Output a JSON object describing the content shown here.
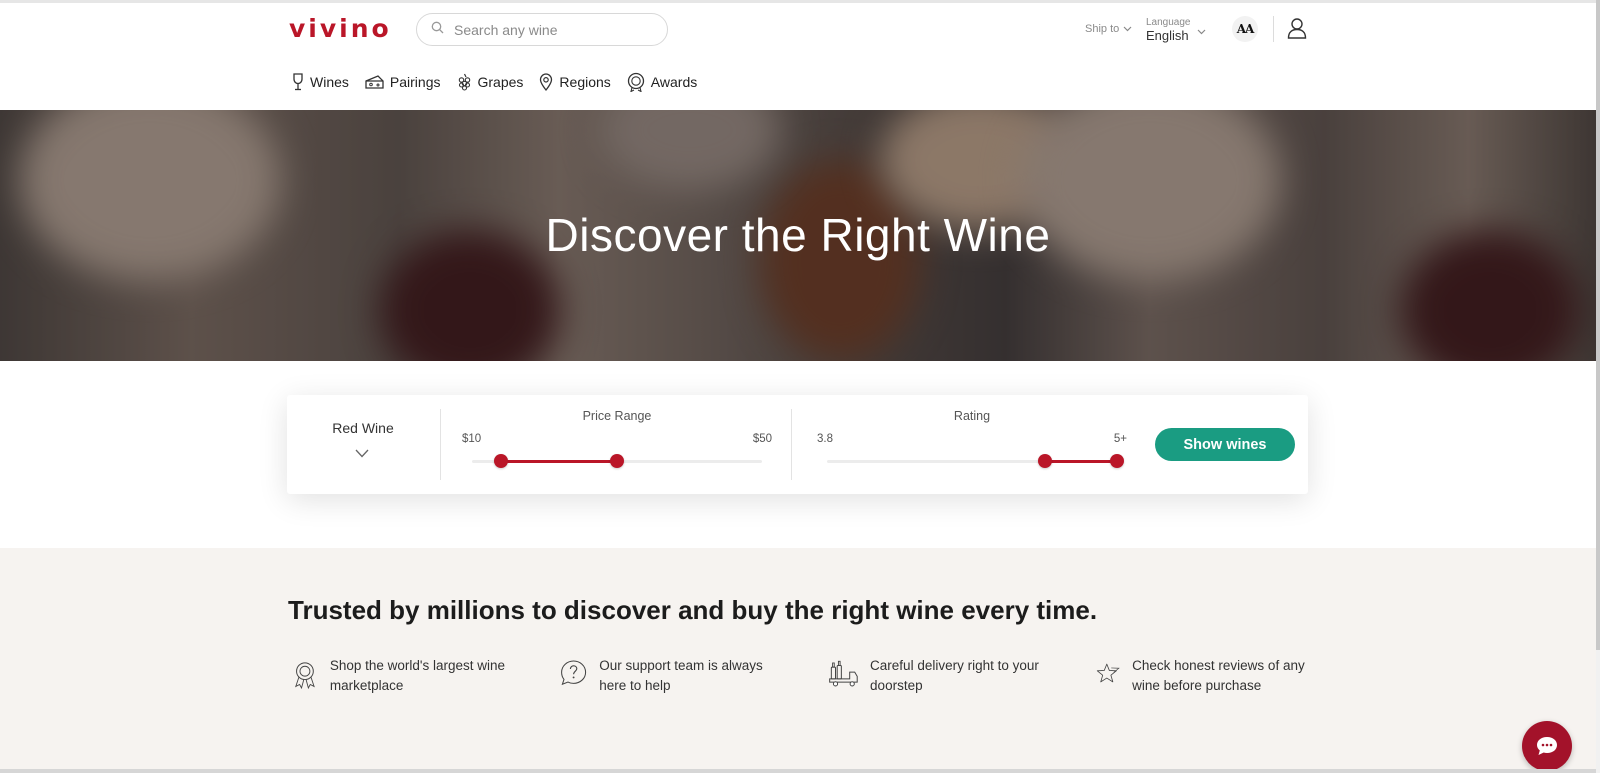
{
  "header": {
    "logo": "vivino",
    "search_placeholder": "Search any wine",
    "ship_to": "Ship to",
    "language_label": "Language",
    "language_value": "English",
    "font_size_toggle": "AA"
  },
  "nav": {
    "items": [
      {
        "label": "Wines",
        "icon": "wine-glass-icon"
      },
      {
        "label": "Pairings",
        "icon": "cheese-icon"
      },
      {
        "label": "Grapes",
        "icon": "grapes-icon"
      },
      {
        "label": "Regions",
        "icon": "map-pin-icon"
      },
      {
        "label": "Awards",
        "icon": "award-icon"
      }
    ]
  },
  "hero": {
    "title": "Discover the Right Wine"
  },
  "filters": {
    "wine_type": "Red Wine",
    "price": {
      "title": "Price Range",
      "min_label": "$10",
      "max_label": "$50",
      "low_fraction": 0.1,
      "high_fraction": 0.5
    },
    "rating": {
      "title": "Rating",
      "min_label": "3.8",
      "max_label": "5+",
      "low_fraction": 0.75,
      "high_fraction": 1.0
    },
    "show_button": "Show wines"
  },
  "trusted": {
    "title": "Trusted by millions to discover and buy the right wine every time.",
    "features": [
      {
        "icon": "award-ribbon-icon",
        "text": "Shop the world's largest wine marketplace"
      },
      {
        "icon": "help-question-icon",
        "text": "Our support team is always here to help"
      },
      {
        "icon": "delivery-truck-icon",
        "text": "Careful delivery right to your doorstep"
      },
      {
        "icon": "star-icon",
        "text": "Check honest reviews of any wine before purchase"
      }
    ]
  },
  "colors": {
    "brand": "#ba1628",
    "button": "#1a9c82",
    "section_bg": "#f6f3f0"
  }
}
